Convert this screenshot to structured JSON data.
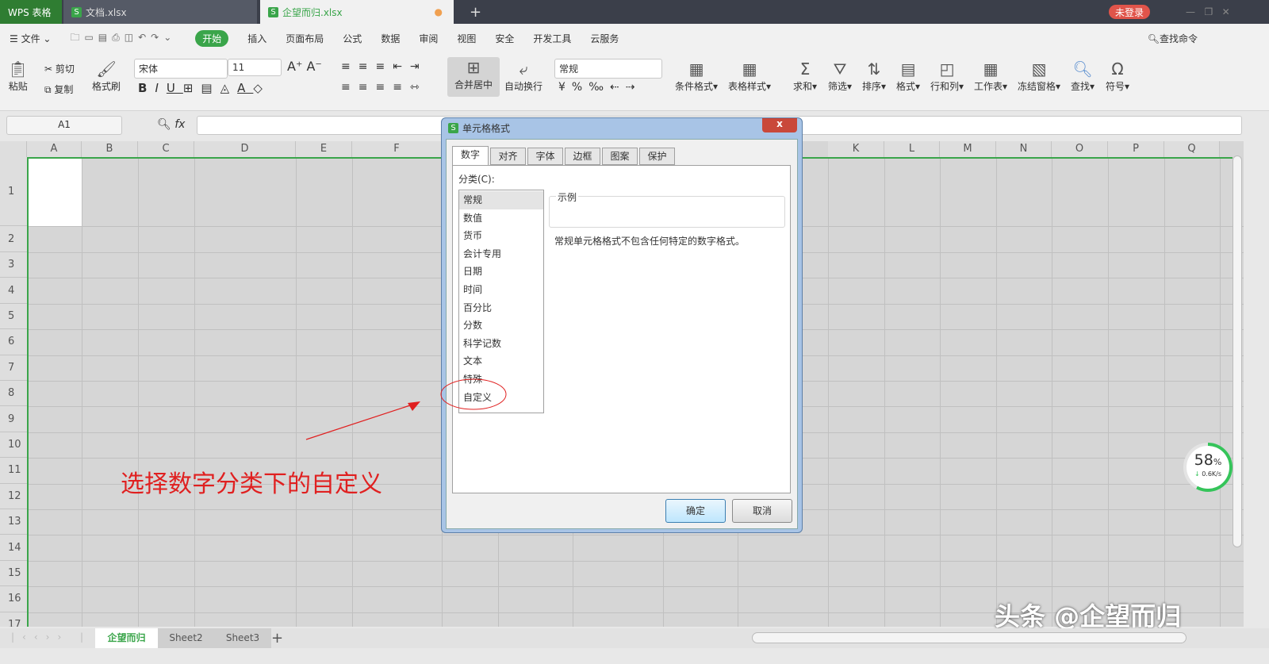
{
  "app": {
    "name": "WPS 表格",
    "tabs": [
      {
        "label": "文档.xlsx"
      },
      {
        "label": "企望而归.xlsx"
      }
    ],
    "login": "未登录"
  },
  "menu": {
    "file": "文件",
    "items": [
      "开始",
      "插入",
      "页面布局",
      "公式",
      "数据",
      "审阅",
      "视图",
      "安全",
      "开发工具",
      "云服务"
    ],
    "active": "开始",
    "search": "查找命令"
  },
  "ribbon": {
    "paste": "粘贴",
    "cut": "剪切",
    "copy": "复制",
    "format_painter": "格式刷",
    "font": "宋体",
    "size": "11",
    "merge": "合并居中",
    "wrap": "自动换行",
    "number_format": "常规",
    "cond_format": "条件格式",
    "table_style": "表格样式",
    "sum": "求和",
    "filter": "筛选",
    "sort": "排序",
    "format": "格式",
    "rowcol": "行和列",
    "worksheet": "工作表",
    "freeze": "冻结窗格",
    "find": "查找",
    "symbol": "符号"
  },
  "formula_bar": {
    "name_box": "A1",
    "fx": "fx",
    "value": ""
  },
  "columns": [
    "A",
    "B",
    "C",
    "D",
    "E",
    "F",
    "K",
    "L",
    "M",
    "N",
    "O",
    "P",
    "Q"
  ],
  "rows": [
    "1",
    "2",
    "3",
    "4",
    "5",
    "6",
    "7",
    "8",
    "9",
    "10",
    "11",
    "12",
    "13",
    "14",
    "15",
    "16",
    "17"
  ],
  "dialog": {
    "title": "单元格格式",
    "close": "x",
    "tabs": [
      "数字",
      "对齐",
      "字体",
      "边框",
      "图案",
      "保护"
    ],
    "category_label": "分类(C):",
    "categories": [
      "常规",
      "数值",
      "货币",
      "会计专用",
      "日期",
      "时间",
      "百分比",
      "分数",
      "科学记数",
      "文本",
      "特殊",
      "自定义"
    ],
    "selected": "常规",
    "sample_label": "示例",
    "description": "常规单元格格式不包含任何特定的数字格式。",
    "ok": "确定",
    "cancel": "取消"
  },
  "annotation": {
    "text": "选择数字分类下的自定义",
    "color": "#e02020"
  },
  "sheets": {
    "tabs": [
      "企望而归",
      "Sheet2",
      "Sheet3"
    ],
    "active": "企望而归",
    "add": "+"
  },
  "speed_widget": {
    "percent": "58",
    "unit": "%",
    "rate": "0.6K/s",
    "progress": 58
  },
  "watermark": "头条 @企望而归",
  "colors": {
    "accent": "#3aa54a",
    "titlebar": "#3b3f4a",
    "login": "#e0544a"
  }
}
